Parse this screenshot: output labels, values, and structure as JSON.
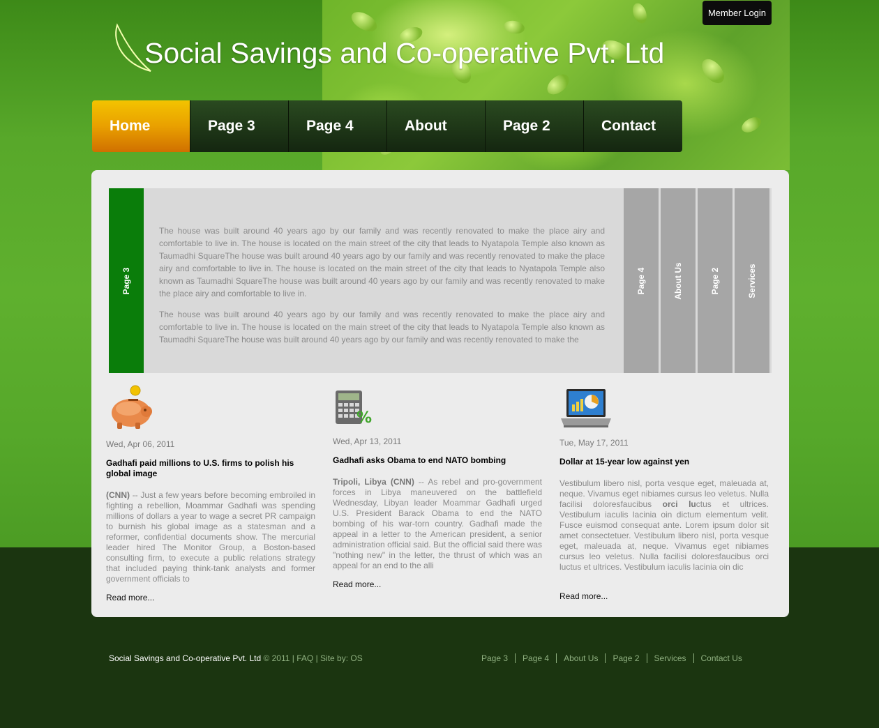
{
  "header": {
    "title": "Social Savings and Co-operative Pvt. Ltd",
    "member_login": "Member Login"
  },
  "nav": {
    "items": [
      {
        "label": "Home",
        "active": true
      },
      {
        "label": "Page 3"
      },
      {
        "label": "Page 4"
      },
      {
        "label": "About"
      },
      {
        "label": "Page 2"
      },
      {
        "label": "Contact"
      }
    ]
  },
  "slider": {
    "active_tab": "Page 3",
    "paragraphs": [
      "The house was built around 40 years ago by our family and was recently renovated to make the place airy and comfortable to live in. The house is located on the main street of the city that leads to Nyatapola Temple also known as Taumadhi SquareThe house was built around 40 years ago by our family and was recently renovated to make the place airy and comfortable to live in. The house is located on the main street of the city that leads to Nyatapola Temple also known as Taumadhi SquareThe house was built around 40 years ago by our family and was recently renovated to make the place airy and comfortable to live in.",
      "The house was built around 40 years ago by our family and was recently renovated to make the place airy and comfortable to live in. The house is located on the main street of the city that leads to Nyatapola Temple also known as Taumadhi SquareThe house was built around 40 years ago by our family and was recently renovated to make the"
    ],
    "side_tabs": [
      "Page 4",
      "About Us",
      "Page 2",
      "Services"
    ]
  },
  "columns": [
    {
      "icon": "piggy-bank-icon",
      "date": "Wed, Apr 06, 2011",
      "headline": "Gadhafi paid millions to U.S. firms to polish his global image",
      "lead": "(CNN)",
      "body": " -- Just a few years before becoming embroiled in fighting a rebellion, Moammar Gadhafi was spending millions of dollars a year to wage a secret PR campaign to burnish his global image as a statesman and a reformer, confidential documents show. The mercurial leader hired The Monitor Group, a Boston-based consulting firm, to execute a public relations strategy that included paying think-tank analysts and former government officials to",
      "read_more": "Read more..."
    },
    {
      "icon": "calculator-icon",
      "date": "Wed, Apr 13, 2011",
      "headline": "Gadhafi asks Obama to end NATO bombing",
      "lead": "Tripoli, Libya (CNN)",
      "body": " -- As rebel and pro-government forces in Libya maneuvered on the battlefield Wednesday, Libyan leader Moammar Gadhafi urged U.S. President Barack Obama to end the NATO bombing of his war-torn country. Gadhafi made the appeal in a letter to the American president, a senior administration official said. But the official said there was \"nothing new\" in the letter, the thrust of which was an appeal for an end to the alli",
      "read_more": "Read more..."
    },
    {
      "icon": "laptop-icon",
      "date": "Tue, May 17, 2011",
      "headline": "Dollar at 15-year low against yen",
      "lead": "",
      "body_parts": [
        "Vestibulum libero nisl, porta vesque eget, maleuada at, neque. Vivamus eget nibiames cursus leo veletus. Nulla facilisi doloresfaucibus ",
        "orci lu",
        "ctus et ultrices. Vestibulum iaculis lacinia oin dictum elementum velit. Fusce euismod consequat ante. Lorem ipsum dolor sit amet consectetuer. Vestibulum libero nisl, porta vesque eget, maleuada at, neque. Vivamus eget nibiames cursus leo veletus. Nulla facilisi doloresfaucibus orci luctus et ultrices. Vestibulum iaculis lacinia oin dic"
      ],
      "read_more": "Read more..."
    }
  ],
  "footer": {
    "company": "Social Savings and Co-operative Pvt. Ltd",
    "copyright": " © 2011 ",
    "faq": "FAQ",
    "site_by": "Site by: OS",
    "links": [
      "Page 3",
      "Page 4",
      "About Us",
      "Page 2",
      "Services",
      "Contact Us"
    ]
  },
  "colors": {
    "accent_orange": "#e9a000",
    "slider_active": "#0a7d0a",
    "side_tab": "#a6a6a6",
    "footer_bg": "#1b3510"
  }
}
